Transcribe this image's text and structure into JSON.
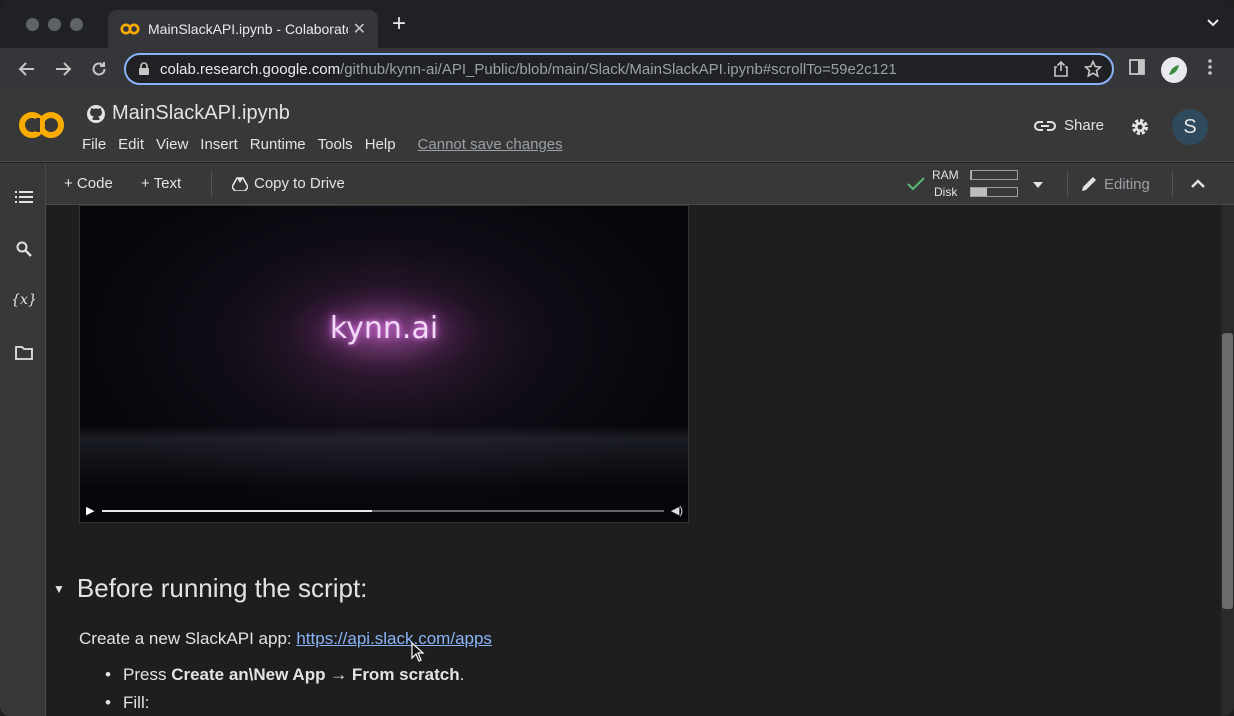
{
  "browser": {
    "tab_title": "MainSlackAPI.ipynb - Colaboratory",
    "new_tab_symbol": "+",
    "close_symbol": "✕",
    "url_host": "colab.research.google.com",
    "url_path": "/github/kynn-ai/API_Public/blob/main/Slack/MainSlackAPI.ipynb#scrollTo=59e2c121",
    "accent_color": "#8ab4f8"
  },
  "colab": {
    "logo_text": "CO",
    "notebook_title": "MainSlackAPI.ipynb",
    "menu": [
      "File",
      "Edit",
      "View",
      "Insert",
      "Runtime",
      "Tools",
      "Help"
    ],
    "cannot_save": "Cannot save changes",
    "share_label": "Share",
    "user_initial": "S",
    "brand_color": "#f9ab00"
  },
  "cell_toolbar": {
    "code_label": "+ Code",
    "text_label": "+ Text",
    "copy_to_drive_label": "Copy to Drive",
    "ram_label": "RAM",
    "disk_label": "Disk",
    "ram_usage": 0.03,
    "disk_usage": 0.35,
    "editing_label": "Editing"
  },
  "sidebar": {
    "icons": [
      "table-of-contents-icon",
      "search-icon",
      "variables-icon",
      "files-icon"
    ],
    "variables_glyph": "{x}"
  },
  "content": {
    "video_brand": "kynn.ai",
    "video_progress": 0.48,
    "section_title": "Before running the script:",
    "intro_text": "Create a new SlackAPI app: ",
    "intro_link": "https://api.slack.com/apps",
    "bullet1_prefix": "Press ",
    "bullet1_bold": "Create an\\New App → From scratch",
    "bullet1_suffix": ".",
    "bullet2": "Fill:"
  }
}
